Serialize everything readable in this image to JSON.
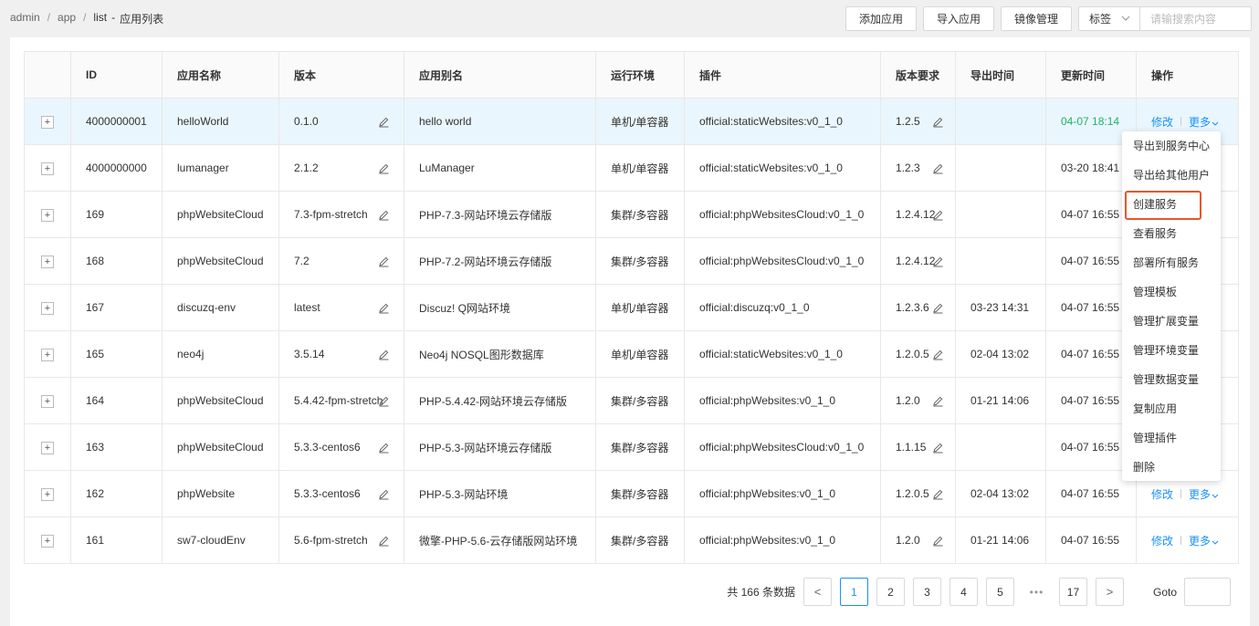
{
  "breadcrumb": {
    "items": [
      "admin",
      "app",
      "list"
    ],
    "separator": "/",
    "title": "应用列表",
    "title_prefix": "-"
  },
  "toolbar": {
    "add_label": "添加应用",
    "import_label": "导入应用",
    "image_label": "镜像管理",
    "tag_label": "标签",
    "search_placeholder": "请输搜索内容"
  },
  "table": {
    "columns": [
      "",
      "ID",
      "应用名称",
      "版本",
      "应用别名",
      "运行环境",
      "插件",
      "版本要求",
      "导出时间",
      "更新时间",
      "操作"
    ],
    "expand_symbol": "+",
    "edit_label": "修改",
    "more_label": "更多",
    "rows": [
      {
        "id": "4000000001",
        "name": "helloWorld",
        "version": "0.1.0",
        "alias": "hello world",
        "env": "单机/单容器",
        "plugin": "official:staticWebsites:v0_1_0",
        "req": "1.2.5",
        "export": "",
        "update": "04-07 18:14",
        "update_green": true,
        "show_ops": true
      },
      {
        "id": "4000000000",
        "name": "lumanager",
        "version": "2.1.2",
        "alias": "LuManager",
        "env": "单机/单容器",
        "plugin": "official:staticWebsites:v0_1_0",
        "req": "1.2.3",
        "export": "",
        "update": "03-20 18:41",
        "show_ops": false
      },
      {
        "id": "169",
        "name": "phpWebsiteCloud",
        "version": "7.3-fpm-stretch",
        "alias": "PHP-7.3-网站环境云存储版",
        "env": "集群/多容器",
        "plugin": "official:phpWebsitesCloud:v0_1_0",
        "req": "1.2.4.12",
        "export": "",
        "update": "04-07 16:55",
        "show_ops": false
      },
      {
        "id": "168",
        "name": "phpWebsiteCloud",
        "version": "7.2",
        "alias": "PHP-7.2-网站环境云存储版",
        "env": "集群/多容器",
        "plugin": "official:phpWebsitesCloud:v0_1_0",
        "req": "1.2.4.12",
        "export": "",
        "update": "04-07 16:55",
        "show_ops": false
      },
      {
        "id": "167",
        "name": "discuzq-env",
        "version": "latest",
        "alias": "Discuz! Q网站环境",
        "env": "单机/单容器",
        "plugin": "official:discuzq:v0_1_0",
        "req": "1.2.3.6",
        "export": "03-23 14:31",
        "update": "04-07 16:55",
        "show_ops": false
      },
      {
        "id": "165",
        "name": "neo4j",
        "version": "3.5.14",
        "alias": "Neo4j NOSQL图形数据库",
        "env": "单机/单容器",
        "plugin": "official:staticWebsites:v0_1_0",
        "req": "1.2.0.5",
        "export": "02-04 13:02",
        "update": "04-07 16:55",
        "show_ops": false
      },
      {
        "id": "164",
        "name": "phpWebsiteCloud",
        "version": "5.4.42-fpm-stretch",
        "alias": "PHP-5.4.42-网站环境云存储版",
        "env": "集群/多容器",
        "plugin": "official:phpWebsites:v0_1_0",
        "req": "1.2.0",
        "export": "01-21 14:06",
        "update": "04-07 16:55",
        "show_ops": false
      },
      {
        "id": "163",
        "name": "phpWebsiteCloud",
        "version": "5.3.3-centos6",
        "alias": "PHP-5.3-网站环境云存储版",
        "env": "集群/多容器",
        "plugin": "official:phpWebsitesCloud:v0_1_0",
        "req": "1.1.15",
        "export": "",
        "update": "04-07 16:55",
        "show_ops": false
      },
      {
        "id": "162",
        "name": "phpWebsite",
        "version": "5.3.3-centos6",
        "alias": "PHP-5.3-网站环境",
        "env": "集群/多容器",
        "plugin": "official:phpWebsites:v0_1_0",
        "req": "1.2.0.5",
        "export": "02-04 13:02",
        "update": "04-07 16:55",
        "show_ops": true
      },
      {
        "id": "161",
        "name": "sw7-cloudEnv",
        "version": "5.6-fpm-stretch",
        "alias": "微擎-PHP-5.6-云存储版网站环境",
        "env": "集群/多容器",
        "plugin": "official:phpWebsites:v0_1_0",
        "req": "1.2.0",
        "export": "01-21 14:06",
        "update": "04-07 16:55",
        "show_ops": true
      }
    ]
  },
  "more_menu": {
    "items": [
      "导出到服务中心",
      "导出给其他用户",
      "创建服务",
      "查看服务",
      "部署所有服务",
      "管理模板",
      "管理扩展变量",
      "管理环境变量",
      "管理数据变量",
      "复制应用",
      "管理插件",
      "删除"
    ],
    "highlighted_index": 2,
    "highlight_color": "#e8562a"
  },
  "pagination": {
    "total_text": "共 166 条数据",
    "pages": [
      "1",
      "2",
      "3",
      "4",
      "5"
    ],
    "ellipsis": "•••",
    "last_page": "17",
    "current": "1",
    "prev_symbol": "<",
    "next_symbol": ">",
    "goto_label": "Goto"
  },
  "colors": {
    "accent": "#1890ff",
    "success": "#20b26b",
    "row_highlight": "#eaf6fd"
  }
}
